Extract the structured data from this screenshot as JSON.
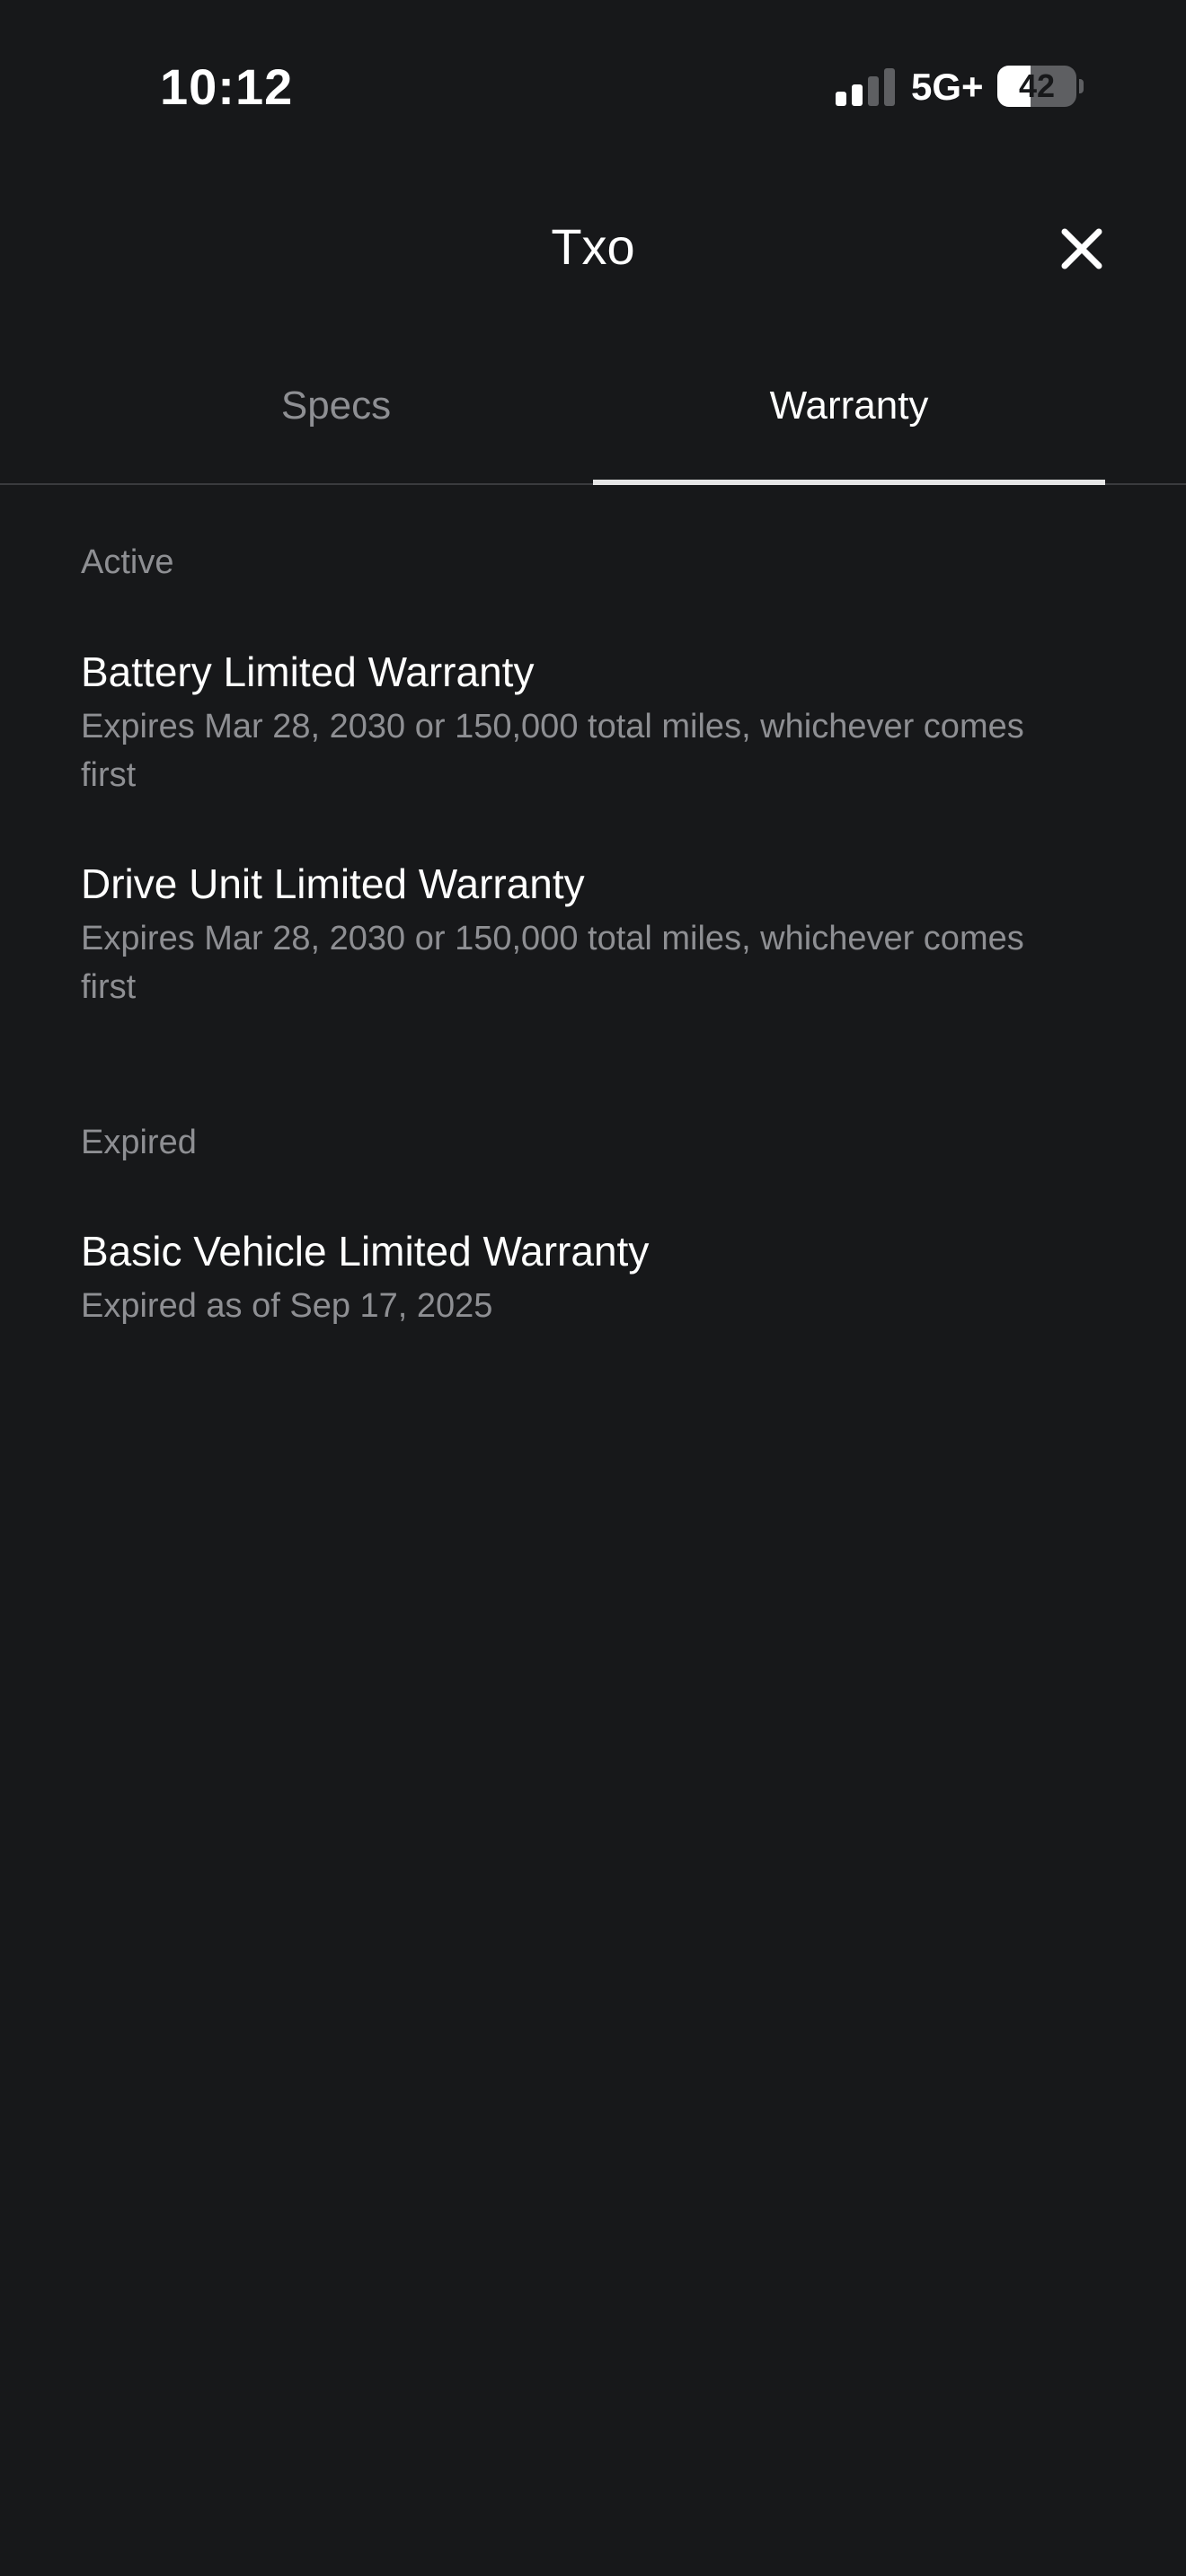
{
  "status_bar": {
    "time": "10:12",
    "network": "5G+",
    "battery_level": "42",
    "battery_fraction": 0.42,
    "signal_bars_active": 2,
    "signal_bars_total": 4
  },
  "header": {
    "title": "Txo",
    "close_icon": "close-icon"
  },
  "tabs": [
    {
      "label": "Specs",
      "active": false
    },
    {
      "label": "Warranty",
      "active": true
    }
  ],
  "sections": {
    "active": {
      "label": "Active",
      "items": [
        {
          "title": "Battery Limited Warranty",
          "description": "Expires Mar 28, 2030 or 150,000 total miles, whichever comes first"
        },
        {
          "title": "Drive Unit Limited Warranty",
          "description": "Expires Mar 28, 2030 or 150,000 total miles, whichever comes first"
        }
      ]
    },
    "expired": {
      "label": "Expired",
      "items": [
        {
          "title": "Basic Vehicle Limited Warranty",
          "description": "Expired as of Sep 17, 2025"
        }
      ]
    }
  },
  "colors": {
    "background": "#17181a",
    "primary_text": "#ffffff",
    "secondary_text": "#8e8f93",
    "tab_indicator": "#e6e6e6",
    "divider": "#3a3b3e"
  }
}
